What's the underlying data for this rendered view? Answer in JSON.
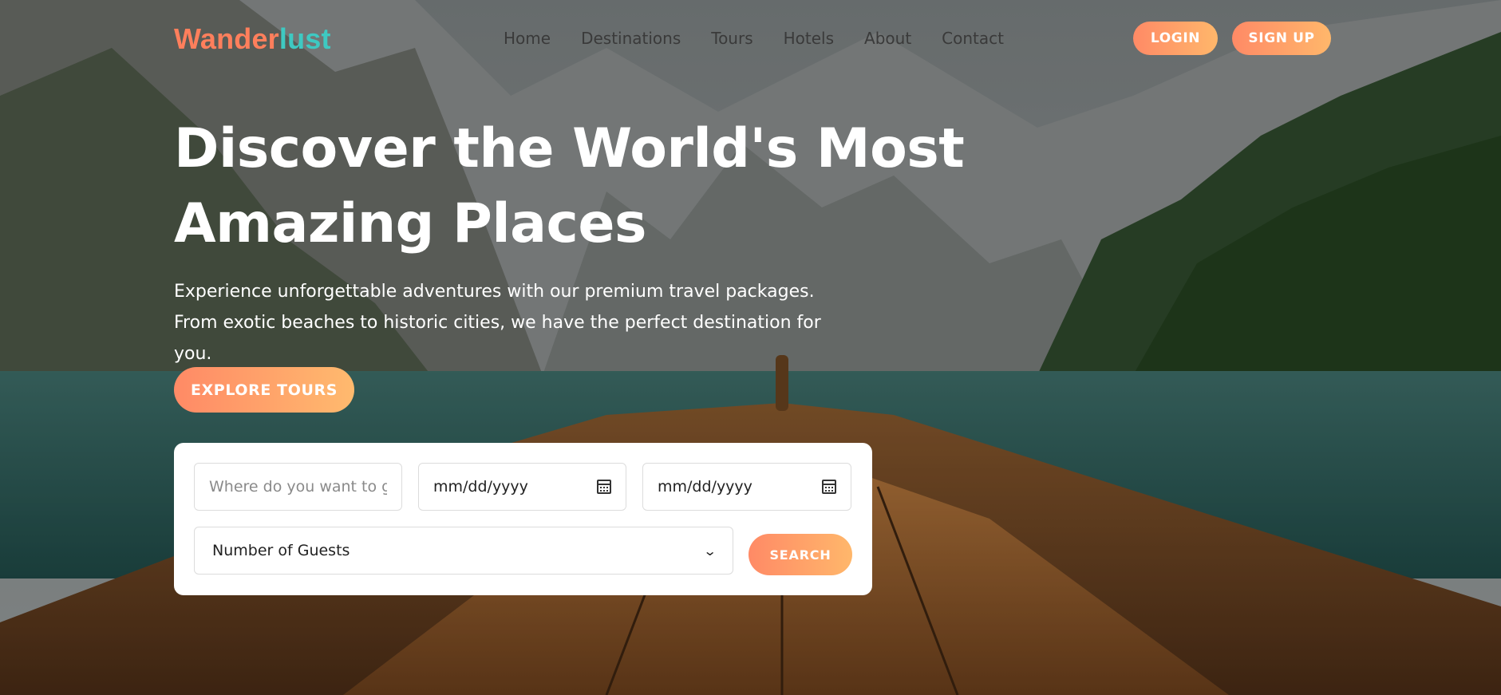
{
  "brand": {
    "part1": "Wander",
    "part2": "lust"
  },
  "nav": {
    "items": [
      "Home",
      "Destinations",
      "Tours",
      "Hotels",
      "About",
      "Contact"
    ]
  },
  "auth": {
    "login": "LOGIN",
    "signup": "SIGN UP"
  },
  "hero": {
    "title": "Discover the World's Most Amazing Places",
    "subtitle": "Experience unforgettable adventures with our premium travel packages. From exotic beaches to historic cities, we have the perfect destination for you.",
    "cta": "EXPLORE TOURS"
  },
  "search": {
    "destination_placeholder": "Where do you want to go?",
    "checkin_value": "mm/dd/yyyy",
    "checkout_value": "mm/dd/yyyy",
    "guests_selected": "Number of Guests",
    "button": "SEARCH"
  },
  "colors": {
    "brand_coral": "#ff7f5c",
    "brand_teal": "#3ec9c2",
    "button_gradient_start": "#ff8a66",
    "button_gradient_end": "#ffb76b"
  },
  "icons": [
    "calendar-icon",
    "chevron-down-icon"
  ]
}
